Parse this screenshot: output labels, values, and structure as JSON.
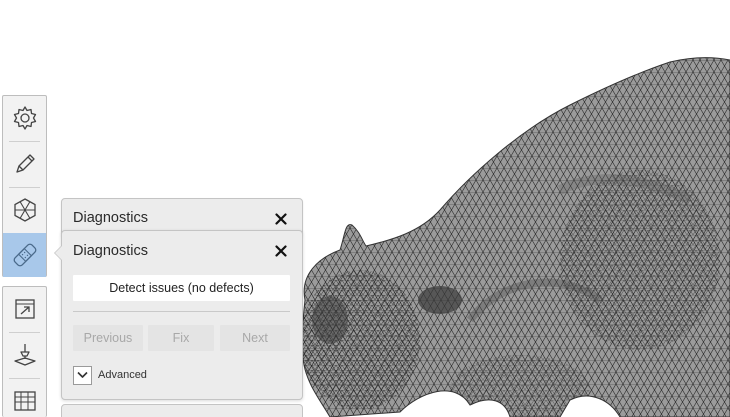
{
  "panels": {
    "back": {
      "title": "Diagnostics",
      "close": "✕"
    },
    "front": {
      "title": "Diagnostics",
      "close": "✕",
      "detect_label": "Detect issues (no defects)",
      "previous_label": "Previous",
      "fix_label": "Fix",
      "next_label": "Next",
      "advanced_label": "Advanced",
      "advanced_expanded": false
    }
  },
  "toolbar": {
    "top_tools": [
      {
        "name": "settings",
        "icon": "gear-icon",
        "active": false
      },
      {
        "name": "edit",
        "icon": "pencil-icon",
        "active": false
      },
      {
        "name": "mesh",
        "icon": "hexagon-mesh-icon",
        "active": false
      },
      {
        "name": "diagnostics",
        "icon": "bandage-icon",
        "active": true
      }
    ],
    "bottom_tools": [
      {
        "name": "export",
        "icon": "export-window-icon",
        "active": false
      },
      {
        "name": "print",
        "icon": "print-arm-icon",
        "active": false
      },
      {
        "name": "layout",
        "icon": "grid-box-icon",
        "active": false
      }
    ]
  },
  "colors": {
    "active_tool": "#a8c8ea",
    "panel_bg": "#ececec",
    "mesh_fill": "#8a8a8a",
    "mesh_line": "#2b2b2b"
  }
}
